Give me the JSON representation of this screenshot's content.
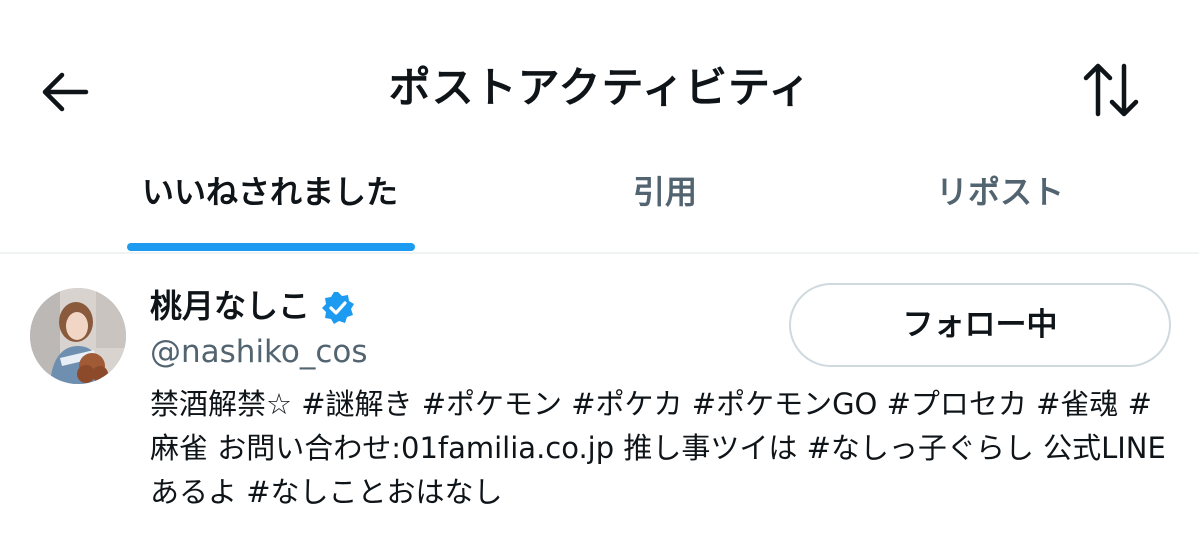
{
  "header": {
    "title": "ポストアクティビティ",
    "back_icon": "arrow-left-icon",
    "sort_icon": "sort-arrows-icon"
  },
  "tabs": [
    {
      "label": "いいねされました",
      "active": true
    },
    {
      "label": "引用",
      "active": false
    },
    {
      "label": "リポスト",
      "active": false
    }
  ],
  "user": {
    "display_name": "桃月なしこ",
    "handle": "@nashiko_cos",
    "verified": true,
    "follow_button_label": "フォロー中",
    "bio": "禁酒解禁☆ #謎解き #ポケモン #ポケカ #ポケモンGO #プロセカ #雀魂 #麻雀 お問い合わせ:01familia.co.jp 推し事ツイは #なしっ子ぐらし 公式LINEあるよ #なしことおはなし"
  },
  "colors": {
    "accent": "#1d9bf0",
    "text_primary": "#0f1419",
    "text_secondary": "#536471",
    "border": "#cfd9de",
    "divider": "#eff3f4"
  }
}
